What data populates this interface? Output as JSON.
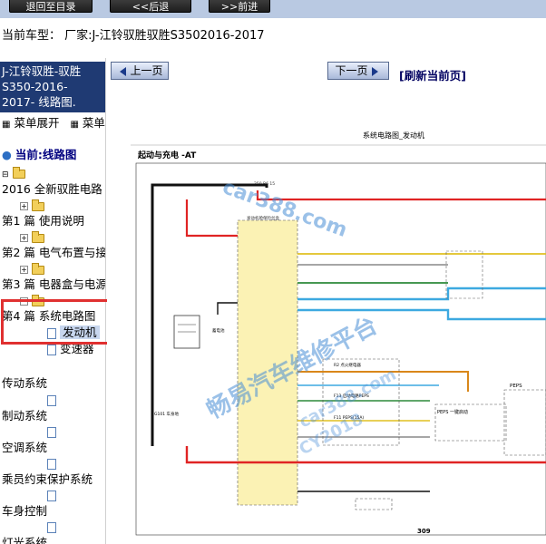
{
  "toolbar": {
    "buttons": [
      "退回至目录",
      "<<后退",
      ">>前进"
    ]
  },
  "vehicle": {
    "label": "当前车型：",
    "value": "厂家:J-江铃驭胜驭胜S3502016-2017"
  },
  "sidebar": {
    "title_lines": [
      "J-江铃驭胜-驭胜",
      "S350-2016-",
      "2017- 线路图."
    ],
    "menu_expand": "菜单展开",
    "menu_more": "菜单",
    "current_label": "当前:线路图",
    "items": [
      "2016 全新驭胜电路",
      "第1 篇 使用说明",
      "第2 篇 电气布置与接",
      "第3 篇 电器盒与电源",
      "第4 篇 系统电路图",
      "发动机",
      "变速器",
      "传动系统",
      "制动系统",
      "空调系统",
      "乘员约束保护系统",
      "车身控制",
      "灯光系统"
    ]
  },
  "nav": {
    "prev": "上一页",
    "next": "下一页",
    "refresh": "[刷新当前页]"
  },
  "diagram": {
    "header": "系统电路图_发动机",
    "subtitle": "起动与充电 -AT",
    "page_number": "309",
    "box_label_1": "R2 点火继电器",
    "box_label_2": "F13 启动电路PEPS",
    "box_label_3": "F11 PEPS(15A)",
    "peps_label": "PEPS",
    "peps_module": "PEPS 一键启动",
    "battery_label": "蓄电池",
    "ground_label": "G101 车身地",
    "junction_label": "发动机舱保险丝盒",
    "fuse_top": "250 B6 15"
  },
  "watermark": {
    "line1": "car388.com",
    "line2": "畅易汽车维修平台",
    "line3": "car388.com",
    "line4": "CY2018"
  },
  "colors": {
    "sidebar_title_bg": "#1f3a73",
    "selection_border": "#e03030",
    "watermark": "#4a8fd6"
  }
}
